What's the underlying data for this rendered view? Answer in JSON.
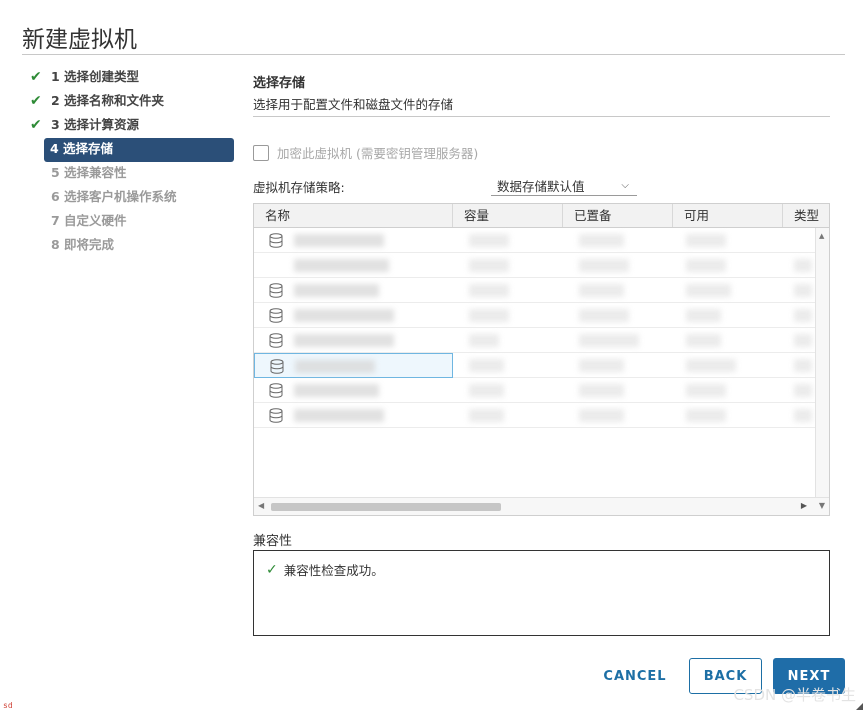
{
  "window": {
    "title": "新建虚拟机"
  },
  "steps": [
    {
      "label": "1 选择创建类型",
      "state": "done"
    },
    {
      "label": "2 选择名称和文件夹",
      "state": "done"
    },
    {
      "label": "3 选择计算资源",
      "state": "done"
    },
    {
      "label": "4 选择存储",
      "state": "active"
    },
    {
      "label": "5 选择兼容性",
      "state": "pending"
    },
    {
      "label": "6 选择客户机操作系统",
      "state": "pending"
    },
    {
      "label": "7 自定义硬件",
      "state": "pending"
    },
    {
      "label": "8 即将完成",
      "state": "pending"
    }
  ],
  "content": {
    "title": "选择存储",
    "subtitle": "选择用于配置文件和磁盘文件的存储",
    "encrypt_label": "加密此虚拟机 (需要密钥管理服务器)",
    "policy_label": "虚拟机存储策略:",
    "policy_value": "数据存储默认值"
  },
  "grid": {
    "columns": [
      "名称",
      "容量",
      "已置备",
      "可用",
      "类型"
    ],
    "row_count": 8,
    "selected_row": 5
  },
  "compatibility": {
    "label": "兼容性",
    "message": "兼容性检查成功。"
  },
  "buttons": {
    "cancel": "CANCEL",
    "back": "BACK",
    "next": "NEXT"
  },
  "watermark": "CSDN @半卷书生",
  "corner_mark": "sd",
  "colors": {
    "accent": "#2b4f78",
    "primary_button": "#1f6da8",
    "success": "#2e8b36",
    "selection_border": "#6fb6e1"
  },
  "icons": {
    "done_step": "check-icon",
    "datastore": "database-icon",
    "dropdown": "chevron-down-icon",
    "success": "check-icon"
  }
}
